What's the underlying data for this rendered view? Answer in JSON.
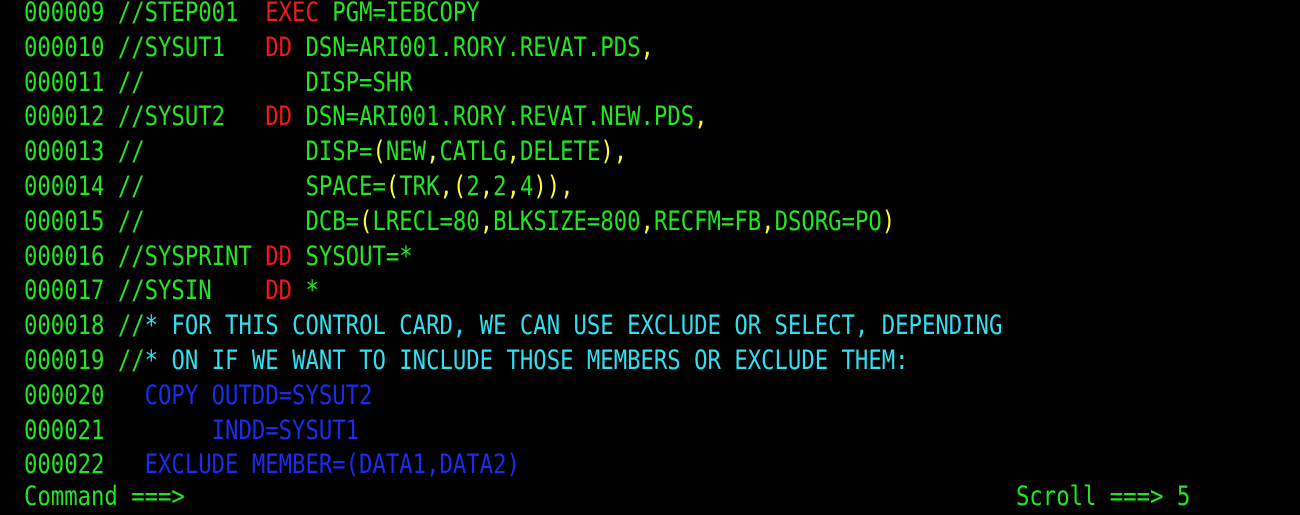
{
  "lines": [
    {
      "num": "000009",
      "seg": [
        "//STEP001  ",
        "EXEC",
        " PGM=IEBCOPY"
      ]
    },
    {
      "num": "000010",
      "seg": [
        "//SYSUT1   ",
        "DD",
        " DSN=ARI001.RORY.REVAT.PDS",
        ","
      ]
    },
    {
      "num": "000011",
      "seg": [
        "//            DISP=SHR"
      ]
    },
    {
      "num": "000012",
      "seg": [
        "//SYSUT2   ",
        "DD",
        " DSN=ARI001.RORY.REVAT.NEW.PDS",
        ","
      ]
    },
    {
      "num": "000013",
      "seg": [
        "//            DISP=",
        "(",
        "NEW",
        ",",
        "CATLG",
        ",",
        "DELETE",
        ")",
        ","
      ]
    },
    {
      "num": "000014",
      "seg": [
        "//            SPACE=",
        "(",
        "TRK",
        ",",
        "(",
        "2",
        ",",
        "2",
        ",",
        "4",
        "))",
        ","
      ]
    },
    {
      "num": "000015",
      "seg": [
        "//            DCB=",
        "(",
        "LRECL=80",
        ",",
        "BLKSIZE=800",
        ",",
        "RECFM=FB",
        ",",
        "DSORG=PO",
        ")"
      ]
    },
    {
      "num": "000016",
      "seg": [
        "//SYSPRINT ",
        "DD",
        " SYSOUT=*"
      ]
    },
    {
      "num": "000017",
      "seg": [
        "//SYSIN    ",
        "DD",
        " *"
      ]
    },
    {
      "num": "000018",
      "seg": [
        "//",
        "* FOR THIS CONTROL CARD, WE CAN USE EXCLUDE OR SELECT, DEPENDING"
      ]
    },
    {
      "num": "000019",
      "seg": [
        "//",
        "* ON IF WE WANT TO INCLUDE THOSE MEMBERS OR EXCLUDE THEM:"
      ]
    },
    {
      "num": "000020",
      "seg": [
        "  COPY OUTDD=SYSUT2"
      ]
    },
    {
      "num": "000021",
      "seg": [
        "       INDD=SYSUT1"
      ]
    },
    {
      "num": "000022",
      "seg": [
        "  EXCLUDE MEMBER=(DATA1,DATA2)"
      ]
    }
  ],
  "command_line": {
    "label": "Command ===>",
    "value": ""
  },
  "scroll": {
    "label": "Scroll ===>",
    "value": "5"
  },
  "colors": {
    "background": "#000000",
    "green": "#22e622",
    "red": "#f01818",
    "yellow": "#ffff30",
    "turquoise": "#30e0f0",
    "blue": "#1a2cf0"
  }
}
